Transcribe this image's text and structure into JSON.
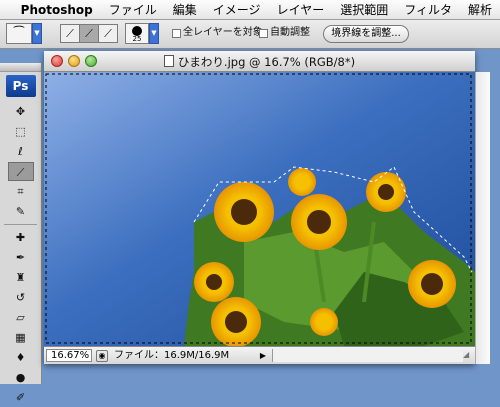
{
  "menubar": {
    "apple_icon": "apple-icon",
    "app_name": "Photoshop",
    "items": [
      "ファイル",
      "編集",
      "イメージ",
      "レイヤー",
      "選択範囲",
      "フィルタ",
      "解析"
    ]
  },
  "options": {
    "brush_size": "25",
    "sample_all_layers_label": "全レイヤーを対象",
    "auto_enhance_label": "自動調整",
    "refine_edge_label": "境界線を調整..."
  },
  "toolbox": {
    "logo": "Ps"
  },
  "document": {
    "title": "ひまわり.jpg @ 16.7% (RGB/8*)",
    "zoom": "16.67%",
    "file_info": "ファイル：16.9M/16.9M"
  },
  "colors": {
    "sky_top": "#7d9dd8",
    "sky_bottom": "#1f4f9c",
    "accent_blue": "#3b73d6",
    "close_red": "#e0443a",
    "minimize_yellow": "#e6a720",
    "zoom_green": "#4fb33a"
  }
}
